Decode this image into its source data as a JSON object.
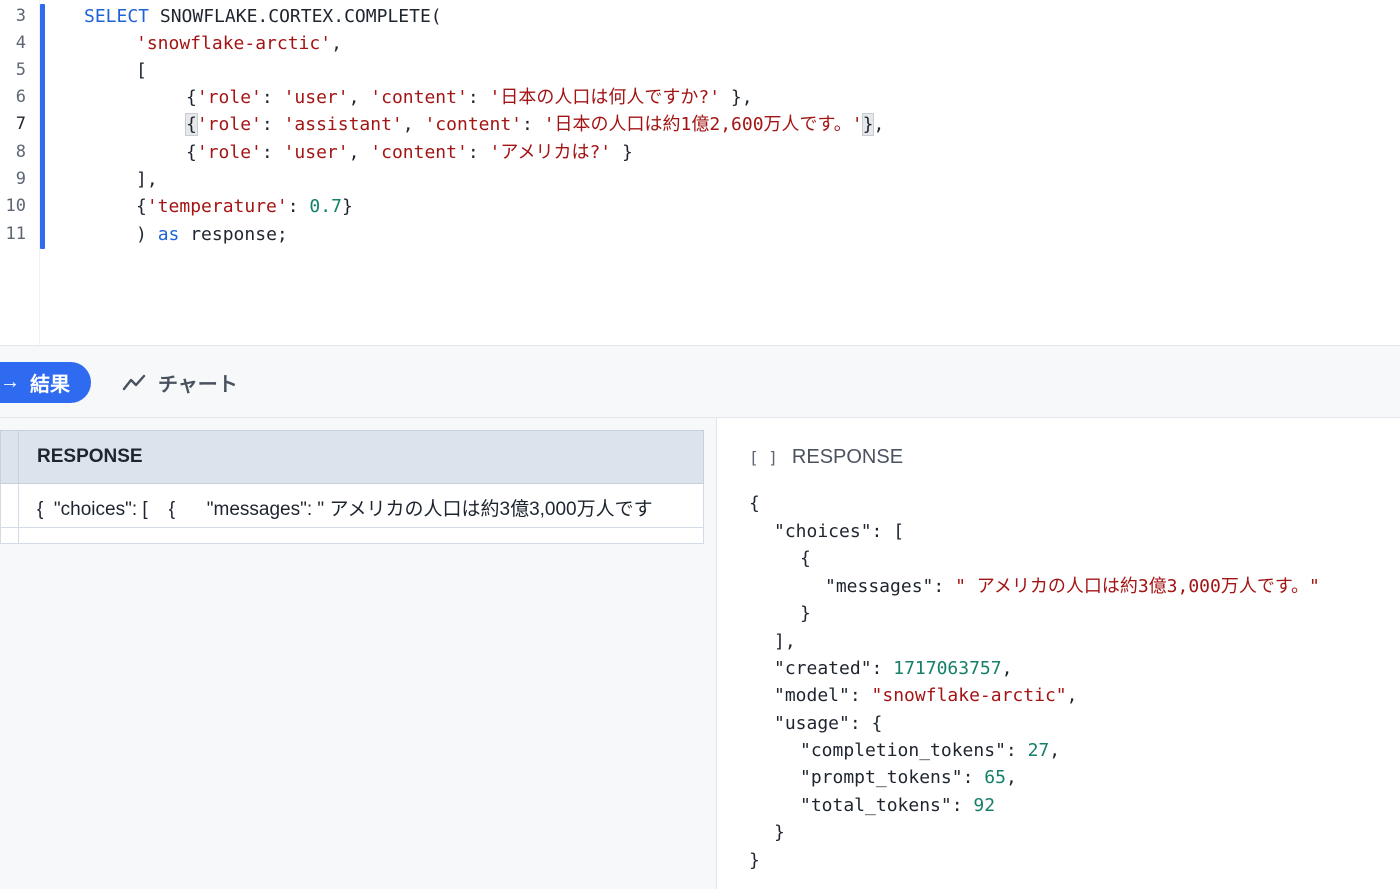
{
  "editor": {
    "line_numbers": [
      "3",
      "4",
      "5",
      "6",
      "7",
      "8",
      "9",
      "10",
      "11"
    ],
    "code": {
      "l3_kw": "SELECT",
      "l3_rest": " SNOWFLAKE.CORTEX.COMPLETE(",
      "l4_str": "'snowflake-arctic'",
      "l4_rest": ",",
      "l5": "[",
      "l6_open": "{",
      "l6_k1": "'role'",
      "l6_v1": "'user'",
      "l6_k2": "'content'",
      "l6_v2": "'日本の人口は何人ですか?'",
      "l6_close": " },",
      "l7_open": "{",
      "l7_k1": "'role'",
      "l7_v1": "'assistant'",
      "l7_k2": "'content'",
      "l7_v2": "'日本の人口は約1億2,600万人です。'",
      "l7_close": "}",
      "l7_tail": ",",
      "l8_open": "{",
      "l8_k1": "'role'",
      "l8_v1": "'user'",
      "l8_k2": "'content'",
      "l8_v2": "'アメリカは?'",
      "l8_close": " }",
      "l9": "],",
      "l10_open": "{",
      "l10_k": "'temperature'",
      "l10_colon": ": ",
      "l10_num": "0.7",
      "l10_close": "}",
      "l11_paren": ") ",
      "l11_kw": "as",
      "l11_rest": " response;"
    }
  },
  "tabs": {
    "results_label": "結果",
    "chart_label": "チャート"
  },
  "grid": {
    "column_header": "RESPONSE",
    "rows": [
      "{  \"choices\": [    {      \"messages\": \" アメリカの人口は約3億3,000万人です"
    ]
  },
  "detail": {
    "icon_glyph": "[ ]",
    "title": "RESPONSE",
    "json": {
      "open": "{",
      "choices_key": "\"choices\"",
      "choices_open": "[",
      "obj_open": "{",
      "messages_key": "\"messages\"",
      "messages_value": "\" アメリカの人口は約3億3,000万人です。\"",
      "obj_close": "}",
      "choices_close": "],",
      "created_key": "\"created\"",
      "created_value": "1717063757",
      "model_key": "\"model\"",
      "model_value": "\"snowflake-arctic\"",
      "usage_key": "\"usage\"",
      "usage_open": "{",
      "completion_key": "\"completion_tokens\"",
      "completion_value": "27",
      "prompt_key": "\"prompt_tokens\"",
      "prompt_value": "65",
      "total_key": "\"total_tokens\"",
      "total_value": "92",
      "usage_close": "}",
      "close": "}"
    }
  },
  "colors": {
    "accent": "#2f6bf0",
    "keyword": "#1f63d6",
    "string": "#a31515",
    "number": "#15806a"
  }
}
